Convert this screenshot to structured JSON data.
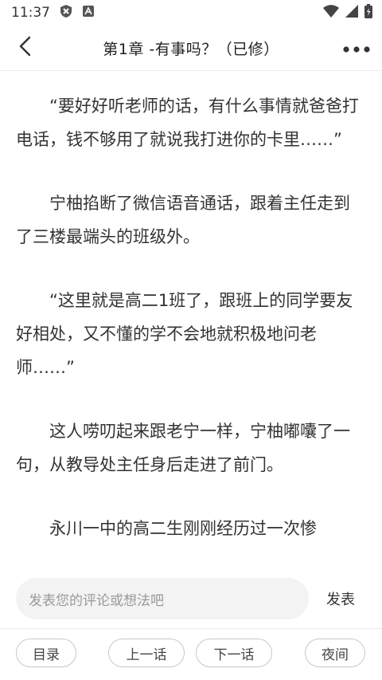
{
  "status_bar": {
    "time": "11:37"
  },
  "header": {
    "title": "第1章 -有事吗？（已修）"
  },
  "content": {
    "paragraphs": [
      "“要好好听老师的话，有什么事情就爸爸打电话，钱不够用了就说我打进你的卡里……”",
      "宁柚掐断了微信语音通话，跟着主任走到了三楼最端头的班级外。",
      "“这里就是高二1班了，跟班上的同学要友好相处，又不懂的学不会地就积极地问老师……”",
      "这人唠叨起来跟老宁一样，宁柚嘟囔了一句，从教导处主任身后走进了前门。",
      "永川一中的高二生刚刚经历过一次惨"
    ]
  },
  "comment": {
    "placeholder": "发表您的评论或想法吧",
    "send_label": "发表"
  },
  "bottom_nav": {
    "catalog": "目录",
    "prev": "上一话",
    "next": "下一话",
    "night": "夜间"
  }
}
